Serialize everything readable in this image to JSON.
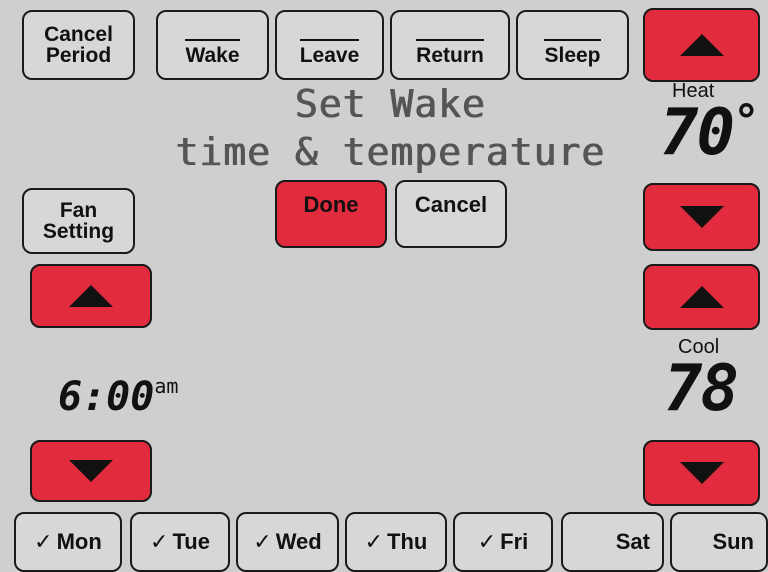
{
  "buttons": {
    "cancel_period": [
      "Cancel",
      "Period"
    ],
    "wake": "Wake",
    "leave": "Leave",
    "return": "Return",
    "sleep": "Sleep",
    "fan_setting": [
      "Fan",
      "Setting"
    ],
    "done": "Done",
    "cancel": "Cancel"
  },
  "display": {
    "line1": "Set Wake",
    "line2": "time & temperature"
  },
  "heat": {
    "label": "Heat",
    "value": "70",
    "unit": "°"
  },
  "cool": {
    "label": "Cool",
    "value": "78"
  },
  "time": {
    "value": "6:00",
    "ampm": "am"
  },
  "days": [
    {
      "label": "Mon",
      "checked": true
    },
    {
      "label": "Tue",
      "checked": true
    },
    {
      "label": "Wed",
      "checked": true
    },
    {
      "label": "Thu",
      "checked": true
    },
    {
      "label": "Fri",
      "checked": true
    },
    {
      "label": "Sat",
      "checked": false
    },
    {
      "label": "Sun",
      "checked": false
    }
  ],
  "check_mark": "✓",
  "colors": {
    "red_button": "#e22b3c",
    "background": "#cfcfcf"
  }
}
